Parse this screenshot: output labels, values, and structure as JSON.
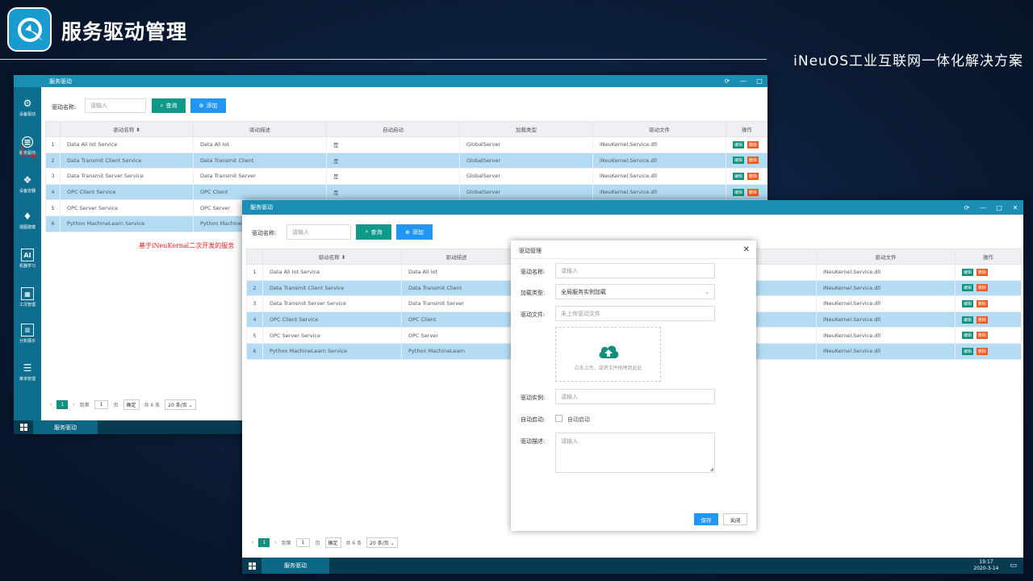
{
  "slide": {
    "title": "服务驱动管理",
    "brand": "iNeuOS工业互联网一体化解决方案"
  },
  "colors": {
    "accent": "#1a8fb3",
    "query": "#0f9988",
    "add": "#2196f3",
    "edit": "#10907d",
    "delete": "#f0581f",
    "selected_row": "#b3dcf4"
  },
  "sidebar": {
    "items": [
      {
        "icon": "gear-cluster-icon",
        "label": "设备驱动"
      },
      {
        "icon": "server-icon",
        "label": "服务驱动"
      },
      {
        "icon": "container-icon",
        "label": "设备容器"
      },
      {
        "icon": "flame-icon",
        "label": "视图建模"
      },
      {
        "icon": "ai-icon",
        "label": "机器学习"
      },
      {
        "icon": "grid-icon",
        "label": "工况管理"
      },
      {
        "icon": "chart-doc-icon",
        "label": "分析展示"
      },
      {
        "icon": "list-icon",
        "label": "菜单管理"
      }
    ]
  },
  "annotation": "基于iNeuKernal二次开发的服务",
  "back_window": {
    "title": "服务驱动",
    "search_label": "驱动名称:",
    "search_placeholder": "请输入",
    "query_label": "查询",
    "add_label": "添加",
    "columns": [
      "驱动名称",
      "驱动描述",
      "自动启动",
      "加载类型",
      "驱动文件",
      "操作"
    ],
    "rows": [
      {
        "num": "1",
        "name": "Data Ali Iot Service",
        "desc": "Data Ali Iot",
        "auto": "是",
        "type": "GlobalServer",
        "file": "iNeuKernel.Service.dll"
      },
      {
        "num": "2",
        "name": "Data Transmit Client Service",
        "desc": "Data Transmit Client",
        "auto": "是",
        "type": "GlobalServer",
        "file": "iNeuKernel.Service.dll"
      },
      {
        "num": "3",
        "name": "Data Transmit Server Service",
        "desc": "Data Transmit Server",
        "auto": "是",
        "type": "GlobalServer",
        "file": "iNeuKernel.Service.dll"
      },
      {
        "num": "4",
        "name": "OPC Client Service",
        "desc": "OPC Client",
        "auto": "是",
        "type": "GlobalServer",
        "file": "iNeuKernel.Service.dll"
      },
      {
        "num": "5",
        "name": "OPC Server Service",
        "desc": "OPC Server",
        "auto": "",
        "type": "",
        "file": ""
      },
      {
        "num": "6",
        "name": "Python MachineLearn Service",
        "desc": "Python MachineL",
        "auto": "",
        "type": "",
        "file": ""
      }
    ],
    "edit_label": "编辑",
    "delete_label": "删除",
    "pager": {
      "current": "1",
      "goto_label": "到第",
      "page_input": "1",
      "page_unit": "页",
      "confirm": "确定",
      "total": "共 6 条",
      "page_size": "20 条/页"
    },
    "taskbar_label": "服务驱动"
  },
  "front_window": {
    "title": "服务驱动",
    "search_label": "驱动名称:",
    "search_placeholder": "请输入",
    "query_label": "查询",
    "add_label": "添加",
    "columns": [
      "驱动名称",
      "驱动描述",
      "驱动文件",
      "操作"
    ],
    "rows": [
      {
        "num": "1",
        "name": "Data Ali Iot Service",
        "desc": "Data Ali Iot",
        "file": "iNeuKernel.Service.dll"
      },
      {
        "num": "2",
        "name": "Data Transmit Client Service",
        "desc": "Data Transmit Client",
        "file": "iNeuKernel.Service.dll"
      },
      {
        "num": "3",
        "name": "Data Transmit Server Service",
        "desc": "Data Transmit Server",
        "file": "iNeuKernel.Service.dll"
      },
      {
        "num": "4",
        "name": "OPC Client Service",
        "desc": "OPC Client",
        "file": "iNeuKernel.Service.dll"
      },
      {
        "num": "5",
        "name": "OPC Server Service",
        "desc": "OPC Server",
        "file": "iNeuKernel.Service.dll"
      },
      {
        "num": "6",
        "name": "Python MachineLearn Service",
        "desc": "Python MachineLearn",
        "file": "iNeuKernel.Service.dll"
      }
    ],
    "edit_label": "编辑",
    "delete_label": "删除",
    "pager": {
      "current": "1",
      "goto_label": "到第",
      "page_input": "1",
      "page_unit": "页",
      "confirm": "确定",
      "total": "共 6 条",
      "page_size": "20 条/页"
    },
    "taskbar_label": "服务驱动",
    "clock_time": "19:17",
    "clock_date": "2020-3-14"
  },
  "dialog": {
    "title": "驱动管理",
    "name_label": "驱动名称:",
    "name_placeholder": "请输入",
    "load_type_label": "加载类型:",
    "load_type_value": "全局服务实例加载",
    "file_label": "驱动文件:",
    "file_placeholder": "未上传驱动文件",
    "upload_hint": "点击上传，或将文件拖拽到此处",
    "instance_label": "驱动实例:",
    "instance_placeholder": "请输入",
    "autostart_label": "自动启动:",
    "autostart_checkbox_label": "自动启动",
    "desc_label": "驱动描述:",
    "desc_placeholder": "请输入",
    "save_label": "保存",
    "close_label": "关闭"
  }
}
